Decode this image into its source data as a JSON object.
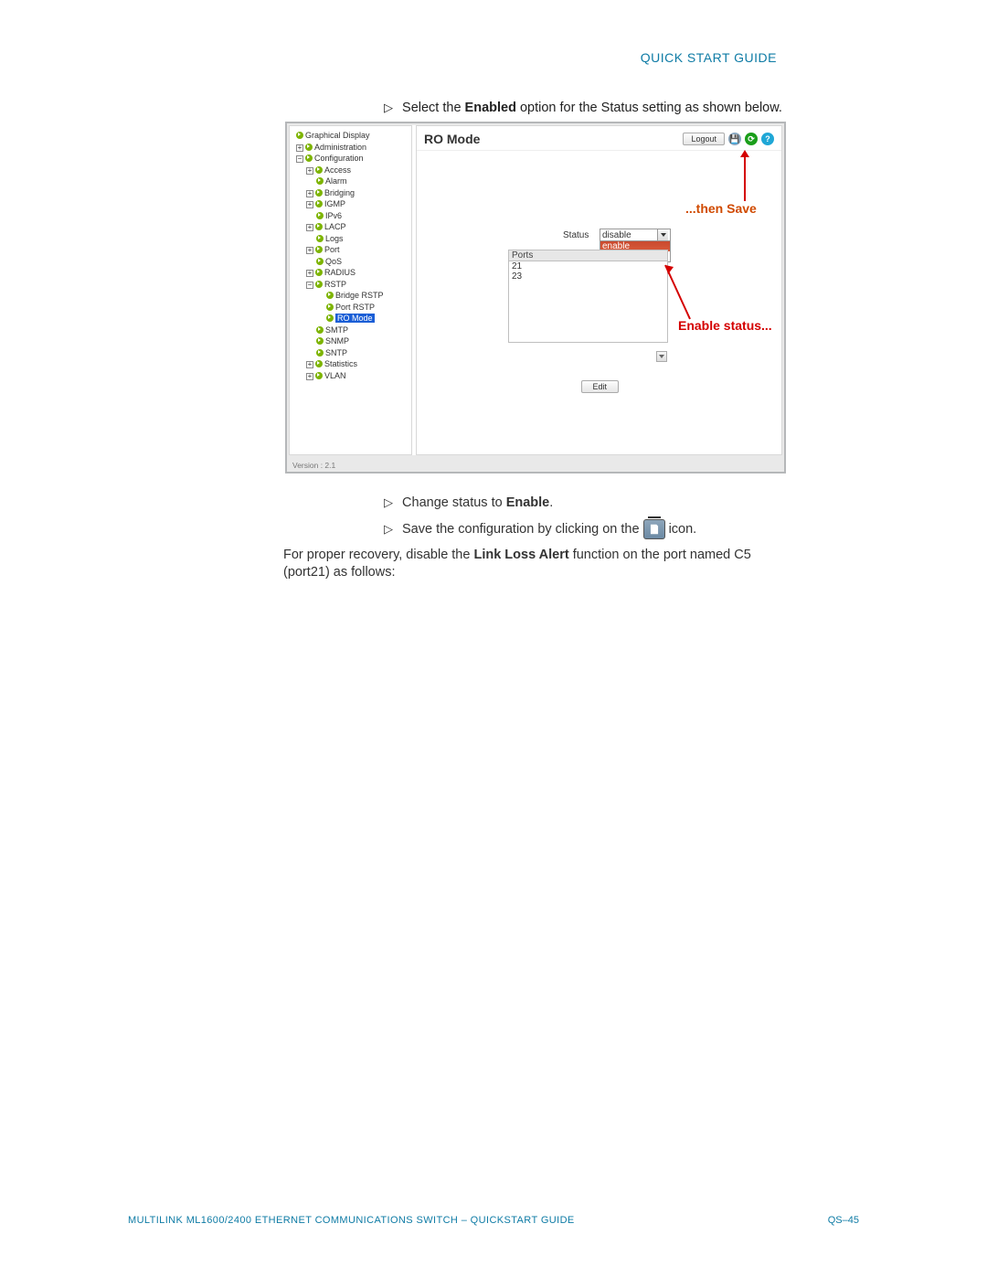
{
  "header_right": "QUICK START GUIDE",
  "instr1_pre": "Select the ",
  "instr1_bold": "Enabled",
  "instr1_post": " option for the Status setting as shown below.",
  "screenshot": {
    "tree": {
      "graphical_display": "Graphical Display",
      "administration": "Administration",
      "configuration": "Configuration",
      "access": "Access",
      "alarm": "Alarm",
      "bridging": "Bridging",
      "igmp": "IGMP",
      "ipv6": "IPv6",
      "lacp": "LACP",
      "logs": "Logs",
      "port": "Port",
      "qos": "QoS",
      "radius": "RADIUS",
      "rstp": "RSTP",
      "bridge_rstp": "Bridge RSTP",
      "port_rstp": "Port RSTP",
      "ro_mode": "RO Mode",
      "smtp": "SMTP",
      "snmp": "SNMP",
      "sntp": "SNTP",
      "statistics": "Statistics",
      "vlan": "VLAN"
    },
    "version": "Version : 2.1",
    "content": {
      "title": "RO Mode",
      "logout": "Logout",
      "status_label": "Status",
      "dropdown_value": "disable",
      "dropdown_opts": {
        "enable": "enable",
        "disable": "disable"
      },
      "ports_header": "Ports",
      "ports": {
        "p21": "21",
        "p23": "23"
      },
      "edit": "Edit"
    }
  },
  "annotation_save": "...then Save",
  "annotation_enable": "Enable status...",
  "instr2_pre": "Change status to ",
  "instr2_bold": "Enable",
  "instr2_post": ".",
  "instr3_pre": "Save the configuration by clicking on the ",
  "instr3_post": " icon.",
  "para_pre": "For proper recovery, disable the ",
  "para_bold": "Link Loss Alert",
  "para_post": " function on the port named C5 (port21) as follows:",
  "footer_left": "MULTILINK ML1600/2400 ETHERNET COMMUNICATIONS SWITCH – QUICKSTART GUIDE",
  "footer_right": "QS–45"
}
